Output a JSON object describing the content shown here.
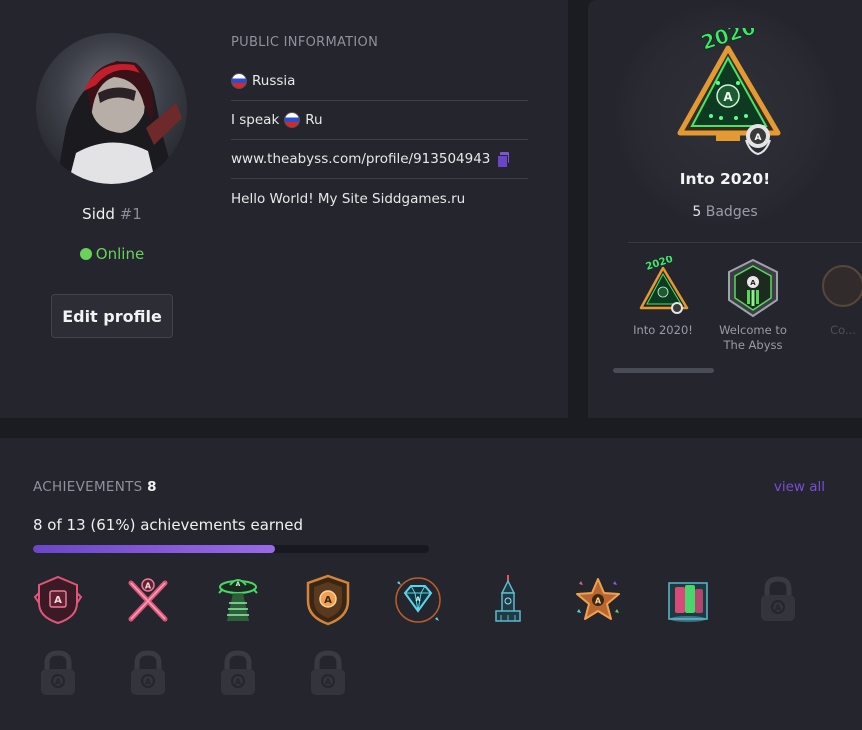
{
  "profile": {
    "name": "Sidd",
    "rank": "#1",
    "status": "Online",
    "edit_label": "Edit profile"
  },
  "public_info": {
    "title": "PUBLIC INFORMATION",
    "country": "Russia",
    "speak_prefix": "I speak",
    "language": "Ru",
    "profile_url": "www.theabyss.com/profile/913504943",
    "bio": "Hello World! My Site Siddgames.ru"
  },
  "badges": {
    "featured_title": "Into 2020!",
    "count": "5",
    "count_label": "Badges",
    "year_text": "2020",
    "items": [
      {
        "label": "Into 2020!",
        "icon": "christmas-tree-badge-icon"
      },
      {
        "label": "Welcome to The Abyss",
        "icon": "shield-green-badge-icon"
      },
      {
        "label": "Co...",
        "icon": "partial-badge-icon"
      }
    ]
  },
  "achievements": {
    "title": "ACHIEVEMENTS",
    "count": "8",
    "view_all": "view all",
    "earned_text": "8 of 13 (61%) achievements earned",
    "progress_fraction": 0.61,
    "icons": [
      "shield-emblem-icon",
      "crossed-swords-icon",
      "ufo-beam-icon",
      "bronze-shield-icon",
      "diamond-icon",
      "tower-icon",
      "star-icon",
      "cards-icon",
      "lock-icon",
      "lock-icon",
      "lock-icon",
      "lock-icon",
      "lock-icon"
    ]
  },
  "colors": {
    "accent": "#7a4dd8",
    "online": "#6ad15d",
    "panel": "#24252d",
    "background": "#1b1c22"
  }
}
